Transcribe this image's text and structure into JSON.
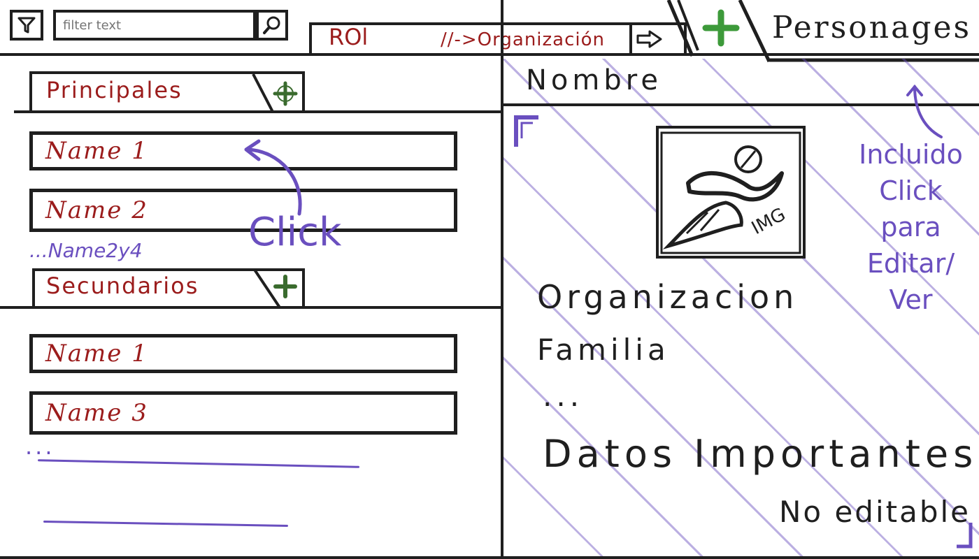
{
  "toolbar": {
    "search_value": "",
    "search_placeholder": "filter text",
    "rol_label": "ROl",
    "rol_org": "//->Organización",
    "personajes_label": "Personages"
  },
  "left": {
    "principales": {
      "title": "Principales",
      "items": [
        "Name 1",
        "Name 2"
      ],
      "more": "...Name2y4"
    },
    "secundarios": {
      "title": "Secundarios",
      "items": [
        "Name 1",
        "Name 3"
      ],
      "more": "..."
    },
    "click_note": "Click"
  },
  "detail": {
    "title": "Nombre",
    "image_label": "IMG",
    "fields": {
      "organizacion": "Organizacion",
      "familia": "Familia",
      "ellipsis": "...",
      "datos": "Datos Importantes",
      "no_editable": "No editable"
    },
    "note_lines": [
      "Incluido",
      "Click",
      "para",
      "Editar/",
      "Ver"
    ]
  },
  "colors": {
    "ink": "#1f1f1f",
    "accent_red": "#9b1c1c",
    "annotation_purple": "#6a4fbf",
    "add_green": "#3d9a3a"
  }
}
